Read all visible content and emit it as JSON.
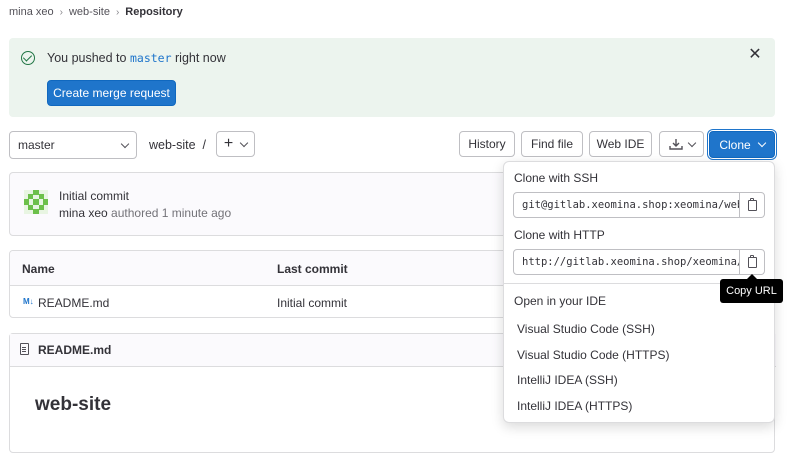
{
  "breadcrumb": {
    "items": [
      "mina xeo",
      "web-site"
    ],
    "current": "Repository"
  },
  "alert": {
    "prefix": "You pushed to",
    "branch": "master",
    "suffix": "right now",
    "action": "Create merge request",
    "close_icon": "close-icon",
    "status_icon": "check-circle-icon",
    "background": "#ecf4ee",
    "icon_color": "#217645"
  },
  "toolbar": {
    "branch": "master",
    "path": "web-site",
    "path_sep": "/",
    "history": "History",
    "find_file": "Find file",
    "web_ide": "Web IDE",
    "clone": "Clone",
    "add_symbol": "+",
    "primary_color": "#1f75cb"
  },
  "commit": {
    "title": "Initial commit",
    "author": "mina xeo",
    "meta": "authored 1 minute ago"
  },
  "files": {
    "headers": {
      "name": "Name",
      "last_commit": "Last commit"
    },
    "rows": [
      {
        "name": "README.md",
        "last_commit": "Initial commit",
        "icon": "markdown-icon"
      }
    ]
  },
  "readme": {
    "filename": "README.md",
    "heading": "web-site"
  },
  "clone_dropdown": {
    "ssh_label": "Clone with SSH",
    "ssh_url": "git@gitlab.xeomina.shop:xeomina/web-site.git",
    "http_label": "Clone with HTTP",
    "http_url": "http://gitlab.xeomina.shop/xeomina/web-site.git",
    "ide_heading": "Open in your IDE",
    "ide_items": [
      "Visual Studio Code (SSH)",
      "Visual Studio Code (HTTPS)",
      "IntelliJ IDEA (SSH)",
      "IntelliJ IDEA (HTTPS)"
    ]
  },
  "tooltip": {
    "text": "Copy URL"
  }
}
